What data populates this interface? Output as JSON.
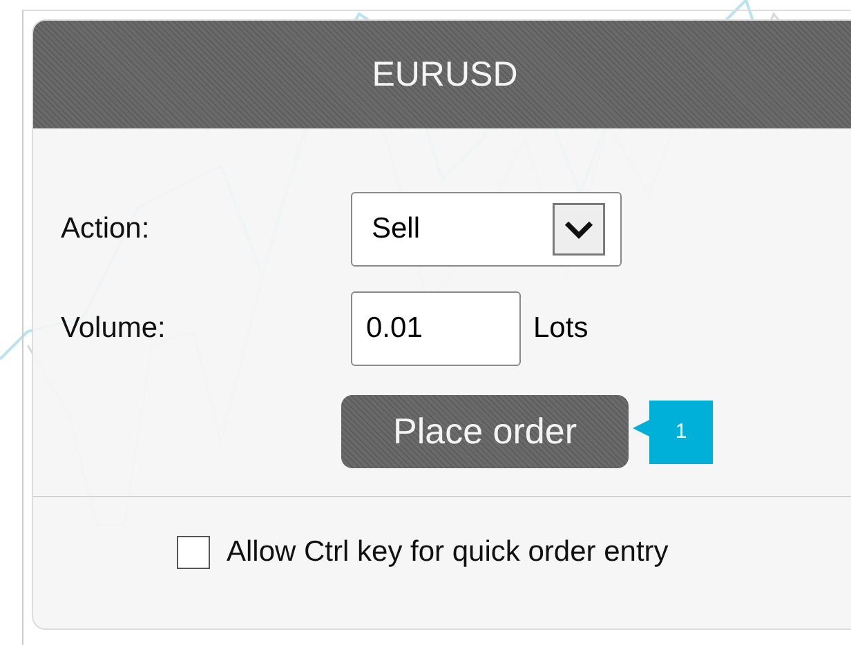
{
  "dialog": {
    "title": "EURUSD",
    "action": {
      "label": "Action:",
      "value": "Sell"
    },
    "volume": {
      "label": "Volume:",
      "value": "0.01",
      "unit": "Lots"
    },
    "button": {
      "label": "Place order"
    },
    "callout": {
      "label": "1"
    },
    "option": {
      "label": "Allow Ctrl key for quick order entry",
      "checked": false
    }
  }
}
